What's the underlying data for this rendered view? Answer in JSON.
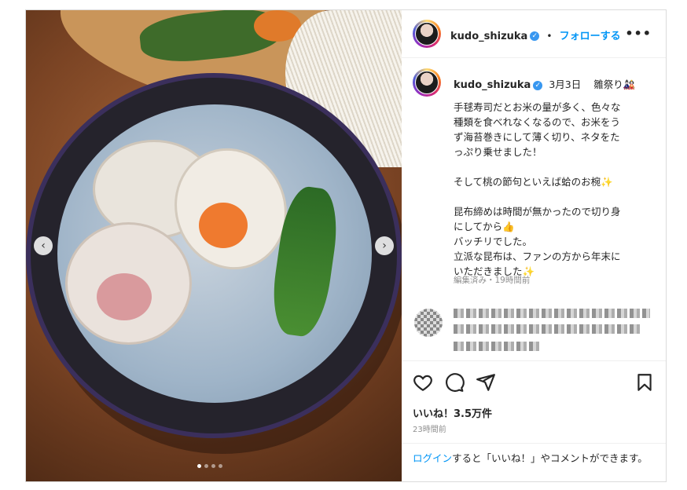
{
  "header": {
    "username": "kudo_shizuka",
    "verified_mark": "✓",
    "separator": "•",
    "follow_label": "フォローする",
    "more_label": "•••"
  },
  "caption": {
    "username": "kudo_shizuka",
    "date": "3月3日",
    "title": "雛祭り🎎",
    "body": "手毬寿司だとお米の量が多く、色々な\n種類を食べれなくなるので、お米をう\nず海苔巻きにして薄く切り、ネタをた\nっぷり乗せました！\n\nそして桃の節句といえば蛤のお椀✨\n\n昆布締めは時間が無かったので切り身\nにしてから👍\nバッチリでした。\n立派な昆布は、ファンの方から年末に\nいただきました✨",
    "meta": "編集済み・19時間前"
  },
  "media": {
    "prev_label": "‹",
    "next_label": "›",
    "slide_count": 4,
    "active_slide": 1
  },
  "actions": {
    "like_icon": "heart-icon",
    "comment_icon": "comment-icon",
    "share_icon": "send-icon",
    "save_icon": "bookmark-icon"
  },
  "likes": "いいね！3.5万件",
  "timestamp": "23時間前",
  "login": {
    "link": "ログイン",
    "rest": "すると「いいね！」やコメントができます。"
  },
  "colors": {
    "accent": "#0095f6",
    "verified": "#3897f0",
    "muted": "#8e8e8e"
  }
}
